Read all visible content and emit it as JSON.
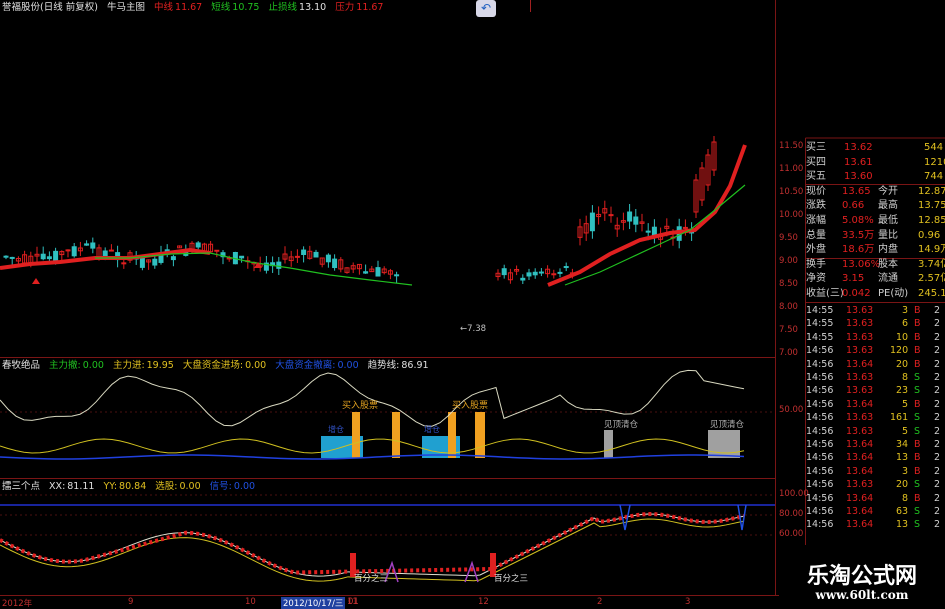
{
  "header": {
    "title": "誉福股份(日线 前复权)",
    "indicator": "牛马主图",
    "mid_label": "中线",
    "mid_value": "11.67",
    "short_label": "短线",
    "short_value": "10.75",
    "stop_label": "止损线",
    "stop_value": "13.10",
    "pressure_label": "压力",
    "pressure_value": "11.67"
  },
  "main_chart": {
    "low_marker": "7.38",
    "price_axis": [
      "11.50",
      "11.00",
      "10.50",
      "10.00",
      "9.50",
      "9.00",
      "8.50",
      "8.00",
      "7.50",
      "7.00"
    ]
  },
  "panel2": {
    "name": "春牧绝品",
    "main_out_label": "主力撤:",
    "main_out_value": "0.00",
    "main_in_label": "主力进:",
    "main_in_value": "19.95",
    "market_label": "大盘资金进场:",
    "market_value": "0.00",
    "blue_label": "大盘资金撤离:",
    "blue_value": "0.00",
    "trend_label": "趋势线:",
    "trend_value": "86.91",
    "buy_label_1": "买入股票",
    "buy_label_2": "买入股票",
    "add_label_1": "增仓",
    "add_label_2": "增仓",
    "sell_label_1": "见顶清仓",
    "sell_label_2": "见顶清仓",
    "axis_value": "50.00"
  },
  "panel3": {
    "name": "擂三个点",
    "xx_label": "XX:",
    "xx_value": "81.11",
    "yy_label": "YY:",
    "yy_value": "80.84",
    "sel_label": "选股:",
    "sel_value": "0.00",
    "sig_label": "信号:",
    "sig_value": "0.00",
    "annot_1": "百分之三",
    "annot_2": "百分之三",
    "axis_top": "100.00",
    "axis_mid": "80.00",
    "axis_low": "60.00"
  },
  "x_axis": {
    "labels": [
      "2012年",
      "9",
      "10",
      "11",
      "2012/10/17/三",
      "01",
      "12",
      "2",
      "3"
    ]
  },
  "quote": {
    "rows": [
      {
        "label": "买三",
        "value": "13.62",
        "vol": "544"
      },
      {
        "label": "买四",
        "value": "13.61",
        "vol": "1210"
      },
      {
        "label": "买五",
        "value": "13.60",
        "vol": "744"
      },
      {
        "label": "现价",
        "value": "13.65",
        "label2": "今开",
        "value2": "12.87"
      },
      {
        "label": "涨跌",
        "value": "0.66",
        "label2": "最高",
        "value2": "13.75"
      },
      {
        "label": "涨幅",
        "value": "5.08%",
        "label2": "最低",
        "value2": "12.85"
      },
      {
        "label": "总量",
        "value": "33.5万",
        "label2": "量比",
        "value2": "0.96"
      },
      {
        "label": "外盘",
        "value": "18.6万",
        "label2": "内盘",
        "value2": "14.9万"
      },
      {
        "label": "换手",
        "value": "13.06%",
        "label2": "股本",
        "value2": "3.74亿"
      },
      {
        "label": "净资",
        "value": "3.15",
        "label2": "流通",
        "value2": "2.57亿"
      },
      {
        "label": "收益(三)",
        "value": "0.042",
        "label2": "PE(动)",
        "value2": "245.1"
      }
    ]
  },
  "ticks": [
    {
      "time": "14:55",
      "price": "13.63",
      "vol": "3",
      "side": "B",
      "extra": "2"
    },
    {
      "time": "14:55",
      "price": "13.63",
      "vol": "6",
      "side": "B",
      "extra": "2"
    },
    {
      "time": "14:55",
      "price": "13.63",
      "vol": "10",
      "side": "B",
      "extra": "2"
    },
    {
      "time": "14:56",
      "price": "13.63",
      "vol": "120",
      "side": "B",
      "extra": "2"
    },
    {
      "time": "14:56",
      "price": "13.64",
      "vol": "20",
      "side": "B",
      "extra": "2"
    },
    {
      "time": "14:56",
      "price": "13.63",
      "vol": "8",
      "side": "S",
      "extra": "2"
    },
    {
      "time": "14:56",
      "price": "13.63",
      "vol": "23",
      "side": "S",
      "extra": "2"
    },
    {
      "time": "14:56",
      "price": "13.64",
      "vol": "5",
      "side": "B",
      "extra": "2"
    },
    {
      "time": "14:56",
      "price": "13.63",
      "vol": "161",
      "side": "S",
      "extra": "2"
    },
    {
      "time": "14:56",
      "price": "13.63",
      "vol": "5",
      "side": "S",
      "extra": "2"
    },
    {
      "time": "14:56",
      "price": "13.64",
      "vol": "34",
      "side": "B",
      "extra": "2"
    },
    {
      "time": "14:56",
      "price": "13.64",
      "vol": "13",
      "side": "B",
      "extra": "2"
    },
    {
      "time": "14:56",
      "price": "13.64",
      "vol": "3",
      "side": "B",
      "extra": "2"
    },
    {
      "time": "14:56",
      "price": "13.63",
      "vol": "20",
      "side": "S",
      "extra": "2"
    },
    {
      "time": "14:56",
      "price": "13.64",
      "vol": "8",
      "side": "B",
      "extra": "2"
    },
    {
      "time": "14:56",
      "price": "13.64",
      "vol": "63",
      "side": "S",
      "extra": "2"
    },
    {
      "time": "14:56",
      "price": "13.64",
      "vol": "13",
      "side": "S",
      "extra": "2"
    }
  ],
  "watermark": {
    "text": "乐淘公式网",
    "url": "www.60lt.com"
  },
  "colors": {
    "up": "#e02020",
    "down": "#30c0c0",
    "ma_green": "#20c020",
    "accent_yellow": "#e0c020",
    "grid": "#8b1a1a"
  }
}
